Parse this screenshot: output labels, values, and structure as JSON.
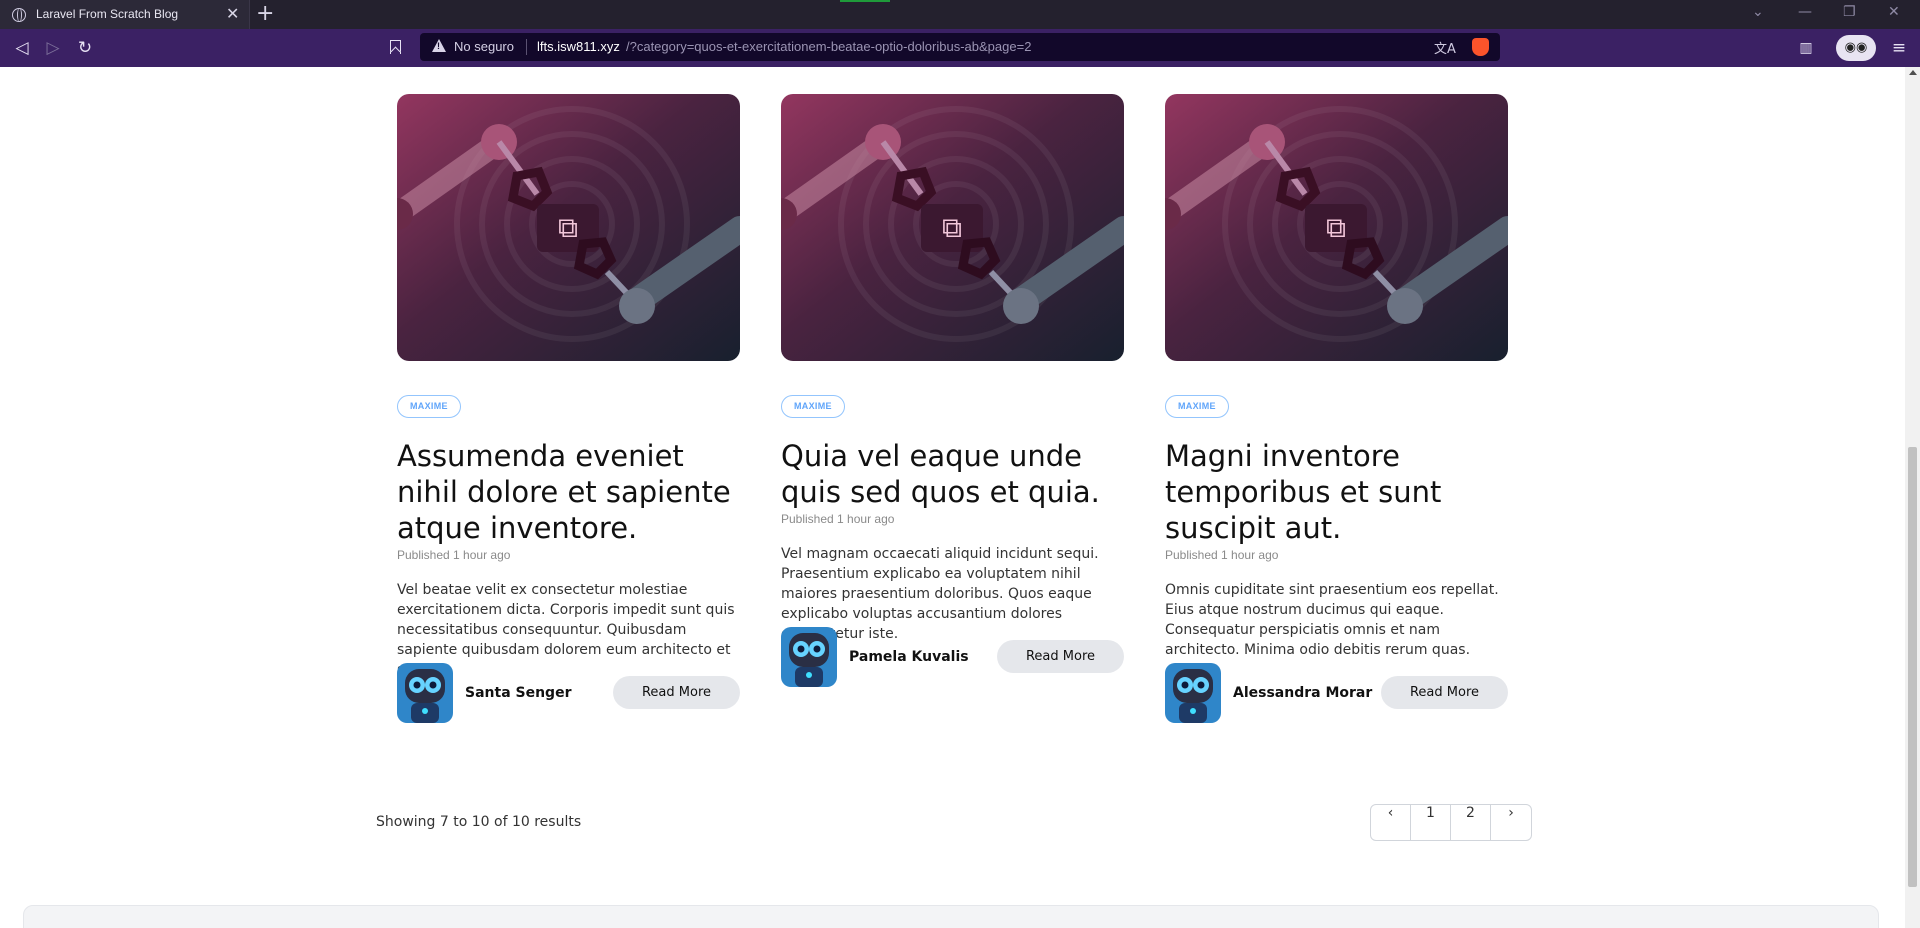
{
  "browser": {
    "tab_title": "Laravel From Scratch Blog",
    "tab_close": "✕",
    "new_tab": "+",
    "insecure_label": "No seguro",
    "url_host": "lfts.isw811.xyz",
    "url_path": "/?category=quos-et-exercitationem-beatae-optio-doloribus-ab&page=2"
  },
  "posts": [
    {
      "category": "MAXIME",
      "title": "Assumenda eveniet nihil dolore et sapiente atque inventore.",
      "published": "Published 1 hour ago",
      "excerpt": "Vel beatae velit ex consectetur molestiae exercitationem dicta. Corporis impedit sunt quis necessitatibus consequuntur. Quibusdam sapiente quibusdam dolorem eum architecto et sed.",
      "author": "Santa Senger",
      "read_more": "Read More"
    },
    {
      "category": "MAXIME",
      "title": "Quia vel eaque unde quis sed quos et quia.",
      "published": "Published 1 hour ago",
      "excerpt": "Vel magnam occaecati aliquid incidunt sequi. Praesentium explicabo ea voluptatem nihil maiores praesentium doloribus. Quos eaque explicabo voluptas accusantium dolores consectetur iste.",
      "author": "Pamela Kuvalis",
      "read_more": "Read More"
    },
    {
      "category": "MAXIME",
      "title": "Magni inventore temporibus et sunt suscipit aut.",
      "published": "Published 1 hour ago",
      "excerpt": "Omnis cupiditate sint praesentium eos repellat. Eius atque nostrum ducimus qui eaque. Consequatur perspiciatis omnis et nam architecto. Minima odio debitis rerum quas.",
      "author": "Alessandra Morar",
      "read_more": "Read More"
    }
  ],
  "pagination": {
    "summary": "Showing 7 to 10 of 10 results",
    "prev": "‹",
    "pages": [
      "1",
      "2"
    ],
    "next": "›"
  }
}
